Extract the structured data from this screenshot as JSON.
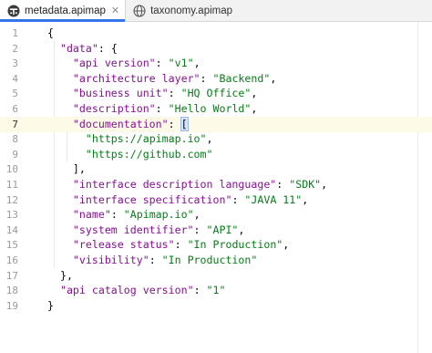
{
  "tabs": [
    {
      "label": "metadata.apimap",
      "active": true,
      "icon": "apimap-file-icon"
    },
    {
      "label": "taxonomy.apimap",
      "active": false,
      "icon": "globe-file-icon"
    }
  ],
  "editor": {
    "current_line": 7,
    "lines": [
      {
        "num": "1",
        "tokens": [
          {
            "t": "{",
            "c": "punct"
          }
        ]
      },
      {
        "num": "2",
        "tokens": [
          {
            "t": "  ",
            "c": "punct"
          },
          {
            "t": "\"data\"",
            "c": "key"
          },
          {
            "t": ": {",
            "c": "punct"
          }
        ]
      },
      {
        "num": "3",
        "tokens": [
          {
            "t": "    ",
            "c": "punct"
          },
          {
            "t": "\"api version\"",
            "c": "key"
          },
          {
            "t": ": ",
            "c": "punct"
          },
          {
            "t": "\"v1\"",
            "c": "str"
          },
          {
            "t": ",",
            "c": "punct"
          }
        ]
      },
      {
        "num": "4",
        "tokens": [
          {
            "t": "    ",
            "c": "punct"
          },
          {
            "t": "\"architecture layer\"",
            "c": "key"
          },
          {
            "t": ": ",
            "c": "punct"
          },
          {
            "t": "\"Backend\"",
            "c": "str"
          },
          {
            "t": ",",
            "c": "punct"
          }
        ]
      },
      {
        "num": "5",
        "tokens": [
          {
            "t": "    ",
            "c": "punct"
          },
          {
            "t": "\"business unit\"",
            "c": "key"
          },
          {
            "t": ": ",
            "c": "punct"
          },
          {
            "t": "\"HQ Office\"",
            "c": "str"
          },
          {
            "t": ",",
            "c": "punct"
          }
        ]
      },
      {
        "num": "6",
        "tokens": [
          {
            "t": "    ",
            "c": "punct"
          },
          {
            "t": "\"description\"",
            "c": "key"
          },
          {
            "t": ": ",
            "c": "punct"
          },
          {
            "t": "\"Hello World\"",
            "c": "str"
          },
          {
            "t": ",",
            "c": "punct"
          }
        ]
      },
      {
        "num": "7",
        "tokens": [
          {
            "t": "    ",
            "c": "punct"
          },
          {
            "t": "\"documentation\"",
            "c": "key"
          },
          {
            "t": ": ",
            "c": "punct"
          },
          {
            "t": "[",
            "c": "bracket"
          },
          {
            "t": "",
            "c": "caret"
          }
        ]
      },
      {
        "num": "8",
        "tokens": [
          {
            "t": "      ",
            "c": "punct"
          },
          {
            "t": "\"https://apimap.io\"",
            "c": "str"
          },
          {
            "t": ",",
            "c": "punct"
          }
        ]
      },
      {
        "num": "9",
        "tokens": [
          {
            "t": "      ",
            "c": "punct"
          },
          {
            "t": "\"https://github.com\"",
            "c": "str"
          }
        ]
      },
      {
        "num": "10",
        "tokens": [
          {
            "t": "    ",
            "c": "punct"
          },
          {
            "t": "],",
            "c": "punct"
          }
        ]
      },
      {
        "num": "11",
        "tokens": [
          {
            "t": "    ",
            "c": "punct"
          },
          {
            "t": "\"interface description language\"",
            "c": "key"
          },
          {
            "t": ": ",
            "c": "punct"
          },
          {
            "t": "\"SDK\"",
            "c": "str"
          },
          {
            "t": ",",
            "c": "punct"
          }
        ]
      },
      {
        "num": "12",
        "tokens": [
          {
            "t": "    ",
            "c": "punct"
          },
          {
            "t": "\"interface specification\"",
            "c": "key"
          },
          {
            "t": ": ",
            "c": "punct"
          },
          {
            "t": "\"JAVA 11\"",
            "c": "str"
          },
          {
            "t": ",",
            "c": "punct"
          }
        ]
      },
      {
        "num": "13",
        "tokens": [
          {
            "t": "    ",
            "c": "punct"
          },
          {
            "t": "\"name\"",
            "c": "key"
          },
          {
            "t": ": ",
            "c": "punct"
          },
          {
            "t": "\"Apimap.io\"",
            "c": "str"
          },
          {
            "t": ",",
            "c": "punct"
          }
        ]
      },
      {
        "num": "14",
        "tokens": [
          {
            "t": "    ",
            "c": "punct"
          },
          {
            "t": "\"system identifier\"",
            "c": "key"
          },
          {
            "t": ": ",
            "c": "punct"
          },
          {
            "t": "\"API\"",
            "c": "str"
          },
          {
            "t": ",",
            "c": "punct"
          }
        ]
      },
      {
        "num": "15",
        "tokens": [
          {
            "t": "    ",
            "c": "punct"
          },
          {
            "t": "\"release status\"",
            "c": "key"
          },
          {
            "t": ": ",
            "c": "punct"
          },
          {
            "t": "\"In Production\"",
            "c": "str"
          },
          {
            "t": ",",
            "c": "punct"
          }
        ]
      },
      {
        "num": "16",
        "tokens": [
          {
            "t": "    ",
            "c": "punct"
          },
          {
            "t": "\"visibility\"",
            "c": "key"
          },
          {
            "t": ": ",
            "c": "punct"
          },
          {
            "t": "\"In Production\"",
            "c": "str"
          }
        ]
      },
      {
        "num": "17",
        "tokens": [
          {
            "t": "  ",
            "c": "punct"
          },
          {
            "t": "},",
            "c": "punct"
          }
        ]
      },
      {
        "num": "18",
        "tokens": [
          {
            "t": "  ",
            "c": "punct"
          },
          {
            "t": "\"api catalog version\"",
            "c": "key"
          },
          {
            "t": ": ",
            "c": "punct"
          },
          {
            "t": "\"1\"",
            "c": "str"
          }
        ]
      },
      {
        "num": "19",
        "tokens": [
          {
            "t": "}",
            "c": "punct"
          }
        ]
      }
    ]
  },
  "colors": {
    "key": "#871094",
    "string": "#067d17",
    "accent": "#3574f0",
    "current_line": "#fdfbe8"
  }
}
